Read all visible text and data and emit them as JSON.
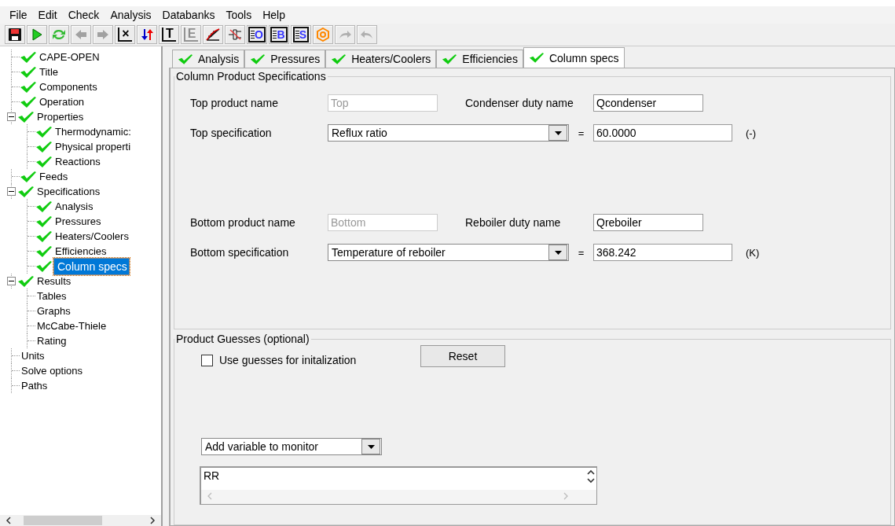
{
  "menu": [
    "File",
    "Edit",
    "Check",
    "Analysis",
    "Databanks",
    "Tools",
    "Help"
  ],
  "toolbar": [
    {
      "kind": "save",
      "disabled": false
    },
    {
      "kind": "run",
      "disabled": false
    },
    {
      "kind": "refresh",
      "disabled": false
    },
    {
      "kind": "back",
      "disabled": true
    },
    {
      "kind": "forward",
      "disabled": true
    },
    {
      "kind": "delete",
      "glyph": "×",
      "disabled": false
    },
    {
      "kind": "swap",
      "disabled": false
    },
    {
      "kind": "letter",
      "glyph": "T",
      "disabled": false
    },
    {
      "kind": "letter",
      "glyph": "E",
      "disabled": true
    },
    {
      "kind": "graph",
      "disabled": false
    },
    {
      "kind": "network",
      "disabled": false
    },
    {
      "kind": "listing",
      "glyph": "O",
      "disabled": false
    },
    {
      "kind": "listing",
      "glyph": "B",
      "disabled": false
    },
    {
      "kind": "listing",
      "glyph": "S",
      "disabled": false
    },
    {
      "kind": "hexagon",
      "disabled": false
    },
    {
      "kind": "redo",
      "disabled": true
    },
    {
      "kind": "undo",
      "disabled": true
    }
  ],
  "tree": [
    {
      "label": "CAPE-OPEN",
      "checked": true,
      "selected": false
    },
    {
      "label": "Title",
      "checked": true,
      "selected": false
    },
    {
      "label": "Components",
      "checked": true,
      "selected": false
    },
    {
      "label": "Operation",
      "checked": true,
      "selected": false
    },
    {
      "label": "Properties",
      "checked": true,
      "selected": false,
      "expanded": true,
      "children": [
        {
          "label": "Thermodynamic:",
          "checked": true,
          "selected": false
        },
        {
          "label": "Physical properti",
          "checked": true,
          "selected": false
        },
        {
          "label": "Reactions",
          "checked": true,
          "selected": false
        }
      ]
    },
    {
      "label": "Feeds",
      "checked": true,
      "selected": false
    },
    {
      "label": "Specifications",
      "checked": true,
      "selected": false,
      "expanded": true,
      "children": [
        {
          "label": "Analysis",
          "checked": true,
          "selected": false
        },
        {
          "label": "Pressures",
          "checked": true,
          "selected": false
        },
        {
          "label": "Heaters/Coolers",
          "checked": true,
          "selected": false
        },
        {
          "label": "Efficiencies",
          "checked": true,
          "selected": false
        },
        {
          "label": "Column specs",
          "checked": true,
          "selected": true
        }
      ]
    },
    {
      "label": "Results",
      "checked": true,
      "selected": false,
      "expanded": true,
      "children": [
        {
          "label": "Tables",
          "checked": false,
          "selected": false
        },
        {
          "label": "Graphs",
          "checked": false,
          "selected": false
        },
        {
          "label": "McCabe-Thiele",
          "checked": false,
          "selected": false
        },
        {
          "label": "Rating",
          "checked": false,
          "selected": false
        }
      ]
    },
    {
      "label": "Units",
      "checked": false,
      "selected": false
    },
    {
      "label": "Solve options",
      "checked": false,
      "selected": false
    },
    {
      "label": "Paths",
      "checked": false,
      "selected": false
    }
  ],
  "tabs": [
    {
      "label": "Analysis",
      "checked": true,
      "selected": false
    },
    {
      "label": "Pressures",
      "checked": true,
      "selected": false
    },
    {
      "label": "Heaters/Coolers",
      "checked": true,
      "selected": false
    },
    {
      "label": "Efficiencies",
      "checked": true,
      "selected": false
    },
    {
      "label": "Column specs",
      "checked": true,
      "selected": true
    }
  ],
  "column_specs": {
    "title": "Column Product Specifications",
    "top_product": {
      "label": "Top product name",
      "value": "Top",
      "disabled": true
    },
    "condenser_duty": {
      "label": "Condenser duty name",
      "value": "Qcondenser",
      "disabled": false
    },
    "top_spec": {
      "label": "Top specification",
      "value": "Reflux ratio",
      "equals": "=",
      "number": "60.0000",
      "unit": "(-)"
    },
    "bottom_product": {
      "label": "Bottom product name",
      "value": "Bottom",
      "disabled": true
    },
    "reboiler_duty": {
      "label": "Reboiler duty name",
      "value": "Qreboiler",
      "disabled": false
    },
    "bottom_spec": {
      "label": "Bottom specification",
      "value": "Temperature of reboiler",
      "equals": "=",
      "number": "368.242",
      "unit": "(K)"
    }
  },
  "product_guesses": {
    "title": "Product Guesses (optional)",
    "checkbox": {
      "label": "Use guesses for initalization",
      "checked": false
    },
    "reset": "Reset",
    "monitor_select": "Add variable to monitor",
    "monitor_list": [
      "RR"
    ]
  }
}
